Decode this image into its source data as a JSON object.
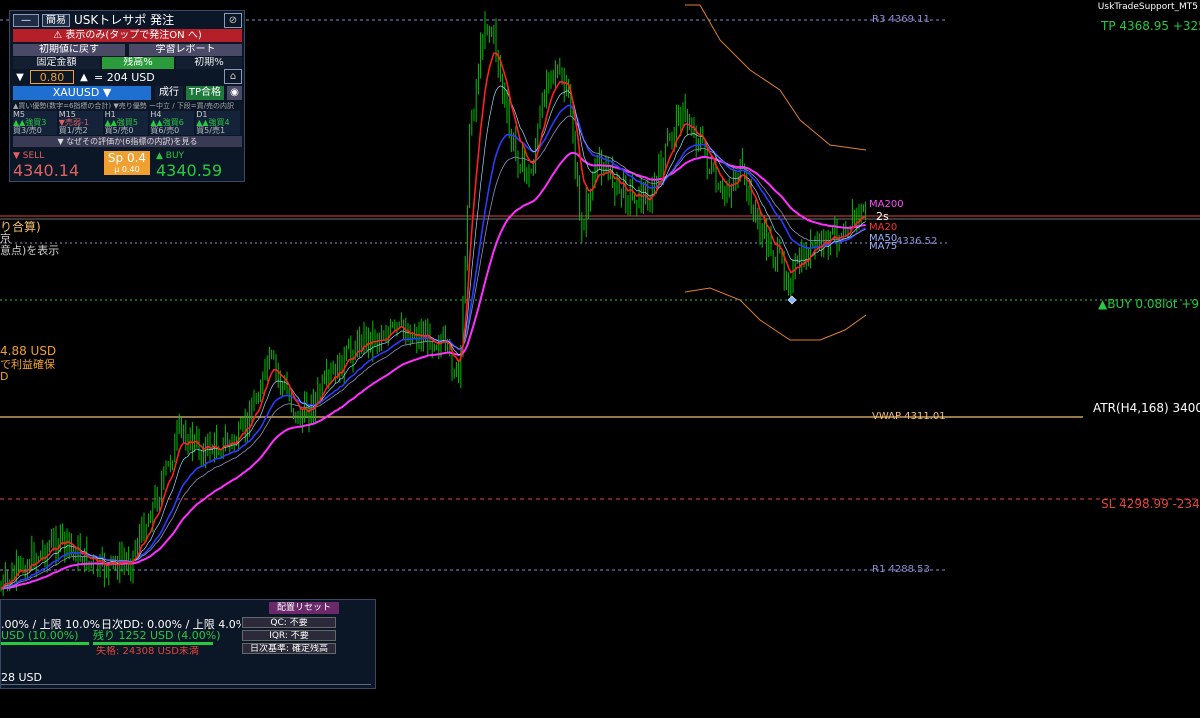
{
  "window": {
    "title": "UskTradeSupport_MT5"
  },
  "levels": {
    "r3": "R3 4369.11",
    "tp": "TP 4368.95 +325",
    "ma200": "MA200",
    "timer": "2s",
    "ma20": "MA20",
    "ma50": "MA50",
    "price_tag": "4336.52",
    "ma75": "MA75",
    "buy": "▲BUY 0.08lot +9",
    "atr": "ATR(H4,168) 3400",
    "vwap": "VWAP 4311.01",
    "sl": "SL 4298.99 -234",
    "r1": "R1 4288.53"
  },
  "left_texts": {
    "t1": "り合算)",
    "t2": "京",
    "t3": "意点)を表示",
    "t4": "4.88 USD",
    "t5": "で利益確保",
    "t6": "D"
  },
  "panel": {
    "menu_btn": "—",
    "mode_btn": "簡易",
    "title": "USKトレサポ 発注",
    "warning": "⚠ 表示のみ(タップで発注ON へ)",
    "reset_btn": "初期値に戻す",
    "report_btn": "学習レポート",
    "tab_fixed": "固定金額",
    "tab_balance": "残高%",
    "tab_initial": "初期%",
    "risk_value": "0.80",
    "risk_equals": "= 204 USD",
    "symbol": "XAUUSD ▼",
    "market_btn": "成行",
    "tp_btn": "TP合格",
    "signal_header": "▲買い優勢(数字=6指標の合計) ▼売り優勢 ー中立 / 下段=買/売の内訳",
    "timeframes": [
      {
        "tf": "M5",
        "sig": "▲▲強買3",
        "sub": "買3/売0"
      },
      {
        "tf": "M15",
        "sig": "▼売弱-1",
        "sub": "買1/売2"
      },
      {
        "tf": "H1",
        "sig": "▲▲強買5",
        "sub": "買5/売0"
      },
      {
        "tf": "H4",
        "sig": "▲▲強買6",
        "sub": "買6/売0"
      },
      {
        "tf": "D1",
        "sig": "▲▲強買4",
        "sub": "買5/売1"
      }
    ],
    "why_btn": "▼ なぜその評価か(6指標の内訳)を見る",
    "sell_label": "▼ SELL",
    "sell_price": "4340.14",
    "spread": "Sp 0.4",
    "spread_sub": "μ 0.40",
    "buy_label": "▲ BUY",
    "buy_price": "4340.59"
  },
  "risk_panel": {
    "reset_btn": "配置リセット",
    "line1": ".00% / 上限 10.0%",
    "line1b": "日次DD: 0.00% / 上限 4.0%",
    "line2": "USD (10.00%)",
    "line2b": "残り 1252 USD (4.00%)",
    "fail": "失格: 24308 USD未満",
    "bottom": "28 USD",
    "qc": "QC: 不要",
    "iqr": "IQR: 不要",
    "daily_basis": "日次基準: 確定残高"
  },
  "colors": {
    "bg": "#000000",
    "candle": "#00c000",
    "ma20": "#ff2020",
    "ma50": "#2a3cff",
    "ma200": "#ff30ff",
    "tp": "#27c93f",
    "sl": "#e0463c",
    "vwap": "#f0c070",
    "pivot": "#8b8bd6",
    "atr_band": "#e08030"
  }
}
